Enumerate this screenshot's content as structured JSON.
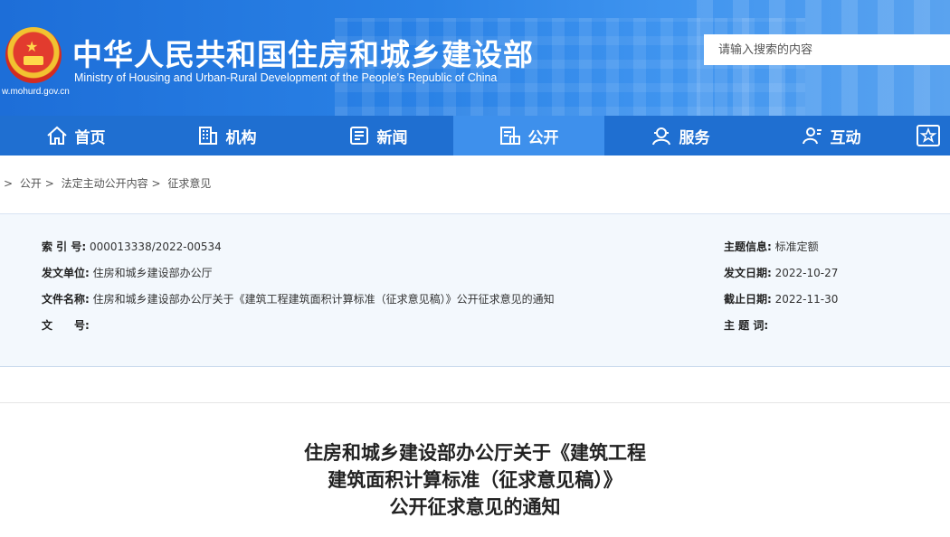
{
  "header": {
    "site_url": "w.mohurd.gov.cn",
    "title": "中华人民共和国住房和城乡建设部",
    "subtitle": "Ministry of Housing and Urban-Rural Development of the People’s Republic of China",
    "search_placeholder": "请输入搜索的内容"
  },
  "nav": {
    "items": [
      {
        "label": "首页",
        "icon": "home-icon"
      },
      {
        "label": "机构",
        "icon": "building-icon"
      },
      {
        "label": "新闻",
        "icon": "news-icon"
      },
      {
        "label": "公开",
        "icon": "public-info-icon",
        "active": true
      },
      {
        "label": "服务",
        "icon": "service-icon"
      },
      {
        "label": "互动",
        "icon": "interaction-icon"
      }
    ],
    "last_icon": "star-icon"
  },
  "breadcrumb": {
    "items": [
      "公开",
      "法定主动公开内容",
      "征求意见"
    ],
    "separator": ">"
  },
  "meta": {
    "index_label": "索 引 号:",
    "index_value": "000013338/2022-00534",
    "issuer_label": "发文单位:",
    "issuer_value": "住房和城乡建设部办公厅",
    "filename_label": "文件名称:",
    "filename_value": "住房和城乡建设部办公厅关于《建筑工程建筑面积计算标准（征求意见稿）》公开征求意见的通知",
    "docno_label": "文　　号:",
    "docno_value": "",
    "topic_label": "主题信息:",
    "topic_value": "标准定额",
    "date_label": "发文日期:",
    "date_value": "2022-10-27",
    "deadline_label": "截止日期:",
    "deadline_value": "2022-11-30",
    "keywords_label": "主 题 词:",
    "keywords_value": ""
  },
  "document": {
    "title_lines": [
      "住房和城乡建设部办公厅关于《建筑工程",
      "建筑面积计算标准（征求意见稿）》",
      "公开征求意见的通知"
    ]
  },
  "colors": {
    "header_blue": "#1d6ed8",
    "nav_blue": "#1f6fd1",
    "nav_active": "#3e90ec",
    "meta_bg": "#f3f8fd"
  }
}
